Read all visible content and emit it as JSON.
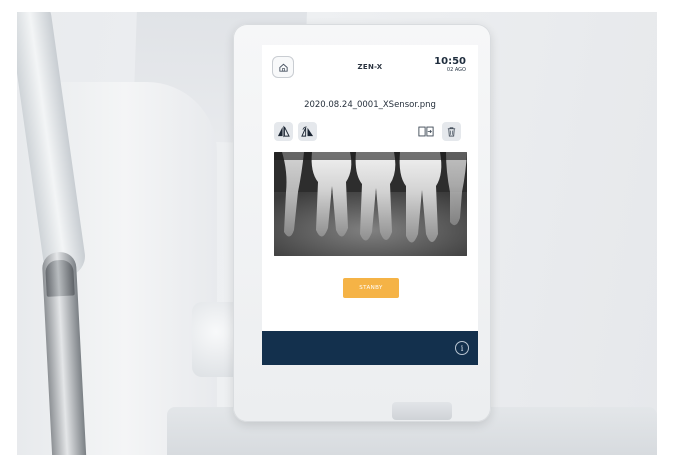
{
  "header": {
    "app_title": "ZEN-X",
    "time": "10:50",
    "date": "02 AGO"
  },
  "image": {
    "filename": "2020.08.24_0001_XSensor.png"
  },
  "toolbar": {
    "icons": [
      "flip-horizontal-icon",
      "flip-vertical-icon",
      "export-icon",
      "trash-icon"
    ]
  },
  "actions": {
    "standby_label": "STANBY"
  },
  "footer": {
    "info_glyph": "i"
  },
  "colors": {
    "accent": "#f5b346",
    "footer": "#13304d",
    "button_bg": "#e5e8ec"
  }
}
